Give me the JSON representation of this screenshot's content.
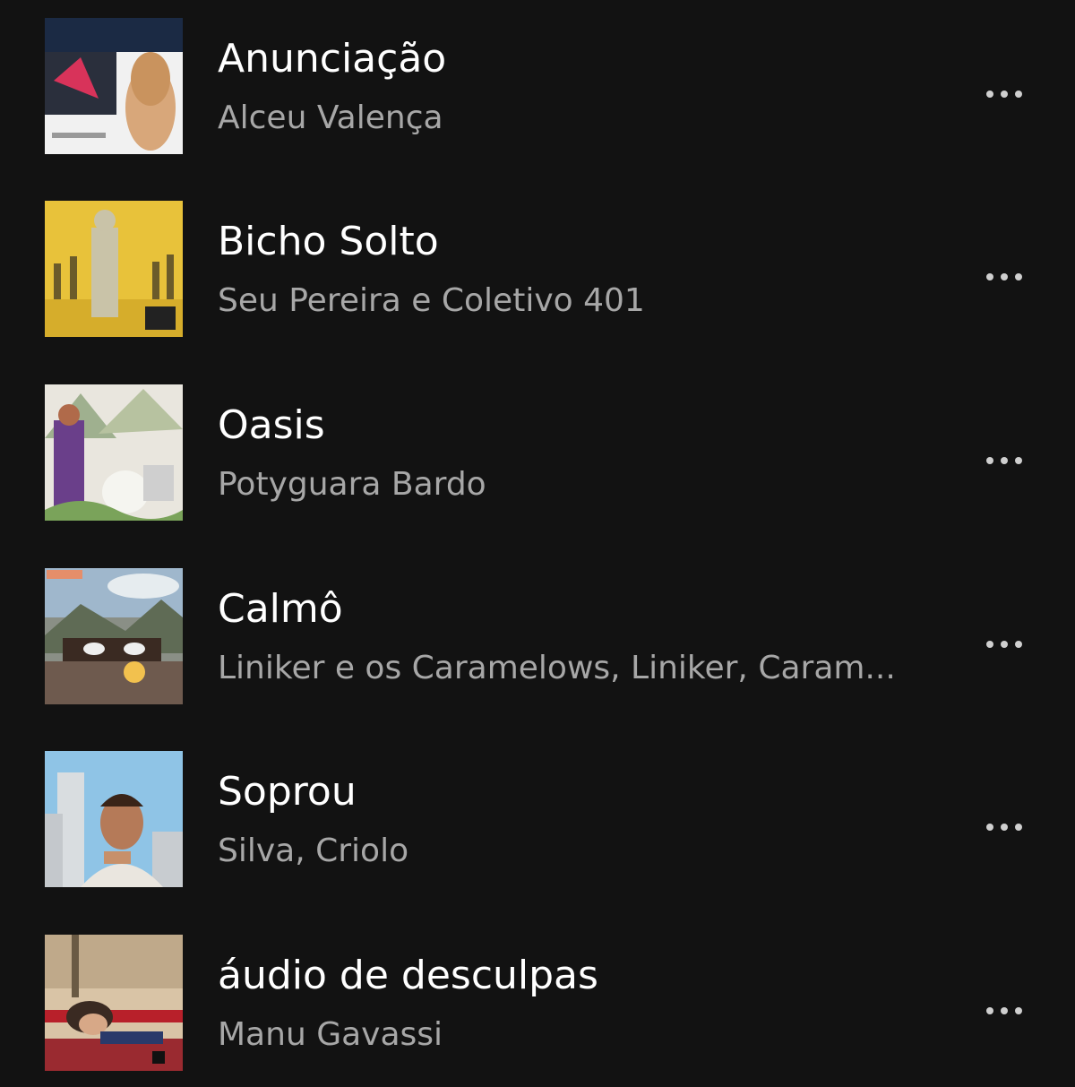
{
  "tracks": [
    {
      "title": "Anunciação",
      "artist": "Alceu Valença",
      "cover_icon": "album-cover-alceu-valenca"
    },
    {
      "title": "Bicho Solto",
      "artist": "Seu Pereira e Coletivo 401",
      "cover_icon": "album-cover-bicho-solto"
    },
    {
      "title": "Oasis",
      "artist": "Potyguara Bardo",
      "cover_icon": "album-cover-oasis"
    },
    {
      "title": "Calmô",
      "artist": "Liniker e os Caramelows, Liniker, Caram...",
      "cover_icon": "album-cover-calmo"
    },
    {
      "title": "Soprou",
      "artist": "Silva, Criolo",
      "cover_icon": "album-cover-soprou"
    },
    {
      "title": "áudio de desculpas",
      "artist": "Manu Gavassi",
      "cover_icon": "album-cover-audio-de-desculpas"
    }
  ],
  "colors": {
    "background": "#121212",
    "title": "#ffffff",
    "artist": "#a7a7a7",
    "more_dots": "#cfcfcf"
  },
  "icons": {
    "more": "ellipsis-horizontal-icon"
  }
}
